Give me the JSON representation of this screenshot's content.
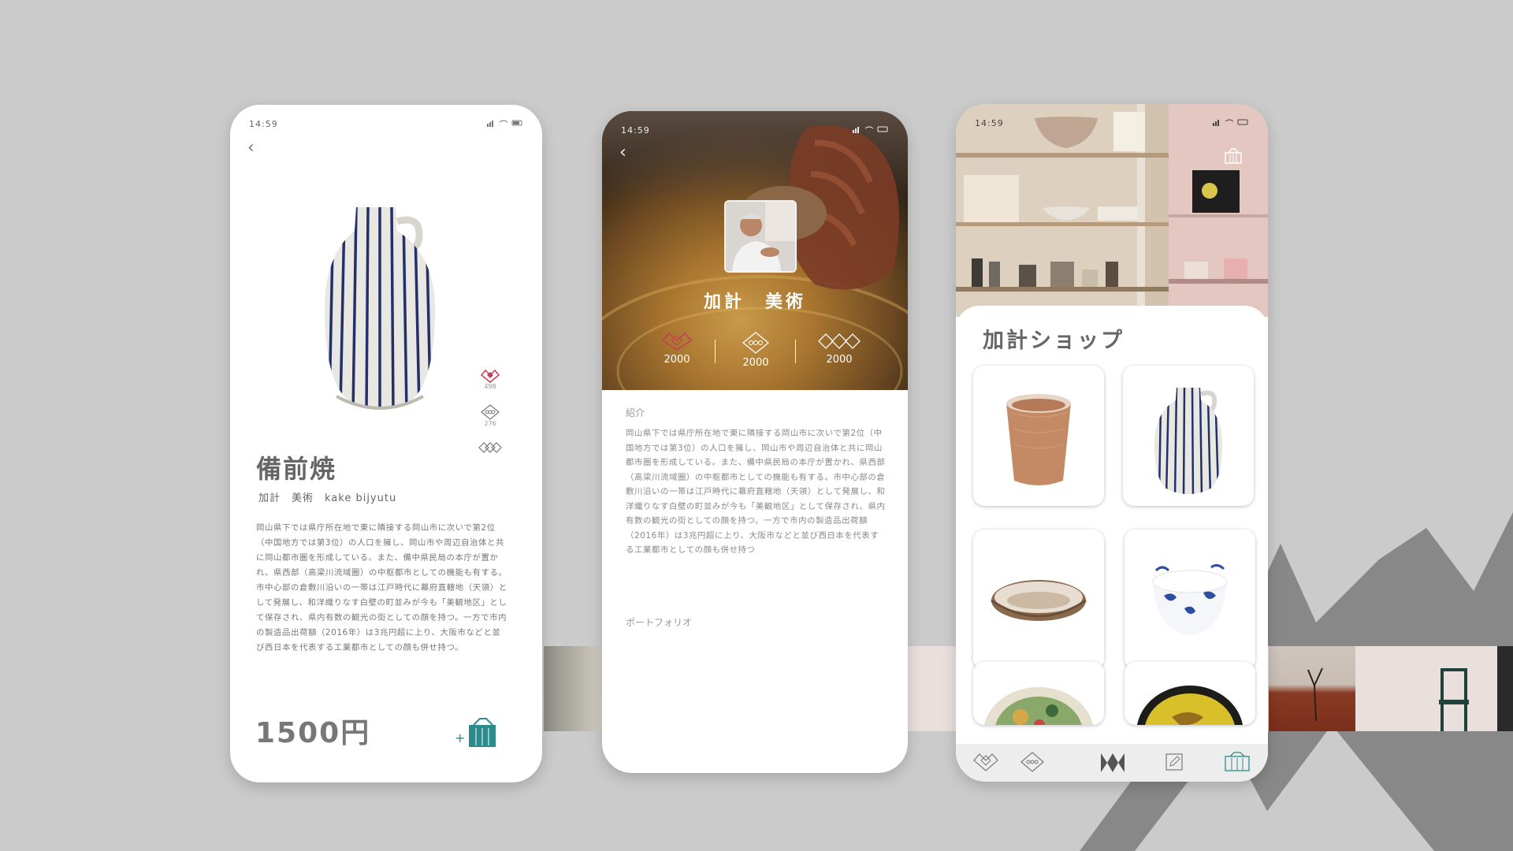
{
  "colors": {
    "background": "#cbcbcb",
    "accent_red": "#c83c58",
    "accent_teal": "#2e8b8b",
    "text_gray": "#666666"
  },
  "product_screen": {
    "status_time": "14:59",
    "back_icon": "chevron-left-icon",
    "side_stats": [
      {
        "icon": "heart-diamond-icon",
        "count": "498"
      },
      {
        "icon": "diamond-circle-icon",
        "count": "276"
      },
      {
        "icon": "triple-diamond-icon",
        "count": ""
      }
    ],
    "title": "備前焼",
    "subtitle": "加計　美術　kake bijyutu",
    "description": "岡山県下では県庁所在地で東に隣接する岡山市に次いで第2位（中国地方では第3位）の人口を擁し、岡山市や周辺自治体と共に岡山都市圏を形成している。また、備中県民局の本庁が置かれ、県西部（高梁川流域圏）の中枢都市としての機能も有する。市中心部の倉敷川沿いの一帯は江戸時代に幕府直轄地（天領）として発展し、和洋織りなす白壁の町並みが今も「美観地区」として保存され、県内有数の観光の街としての顔を持つ。一方で市内の製造品出荷額（2016年）は3兆円超に上り、大阪市などと並び西日本を代表する工業都市としての顔も併せ持つ。",
    "price": "1500円",
    "add_to_cart_icon": "shopping-bag-plus-icon"
  },
  "artist_screen": {
    "status_time": "14:59",
    "name": "加計　美術",
    "stats": [
      {
        "icon": "heart-diamond-icon",
        "value": "2000"
      },
      {
        "icon": "diamond-circle-icon",
        "value": "2000"
      },
      {
        "icon": "triple-diamond-icon",
        "value": "2000"
      }
    ],
    "intro_label": "紹介",
    "intro_text": "岡山県下では県庁所在地で東に隣接する岡山市に次いで第2位（中国地方では第3位）の人口を擁し、岡山市や周辺自治体と共に岡山都市圏を形成している。また、備中県民局の本庁が置かれ、県西部（高梁川流域圏）の中枢都市としての機能も有する。市中心部の倉敷川沿いの一帯は江戸時代に幕府直轄地（天領）として発展し、和洋織りなす白壁の町並みが今も「美観地区」として保存され、県内有数の観光の街としての顔を持つ。一方で市内の製造品出荷額（2016年）は3兆円超に上り、大阪市などと並び西日本を代表する工業都市としての顔も併せ持つ",
    "portfolio_label": "ポートフォリオ"
  },
  "shop_screen": {
    "status_time": "14:59",
    "title": "加計ショップ",
    "products": [
      "cup",
      "striped-vase",
      "bowl",
      "blue-white-bowl",
      "green-plate",
      "yellow-plate"
    ],
    "tabs": [
      "heart-diamond-icon",
      "diamond-circle-icon",
      "mountain-logo-icon",
      "edit-icon",
      "shop-icon"
    ]
  }
}
